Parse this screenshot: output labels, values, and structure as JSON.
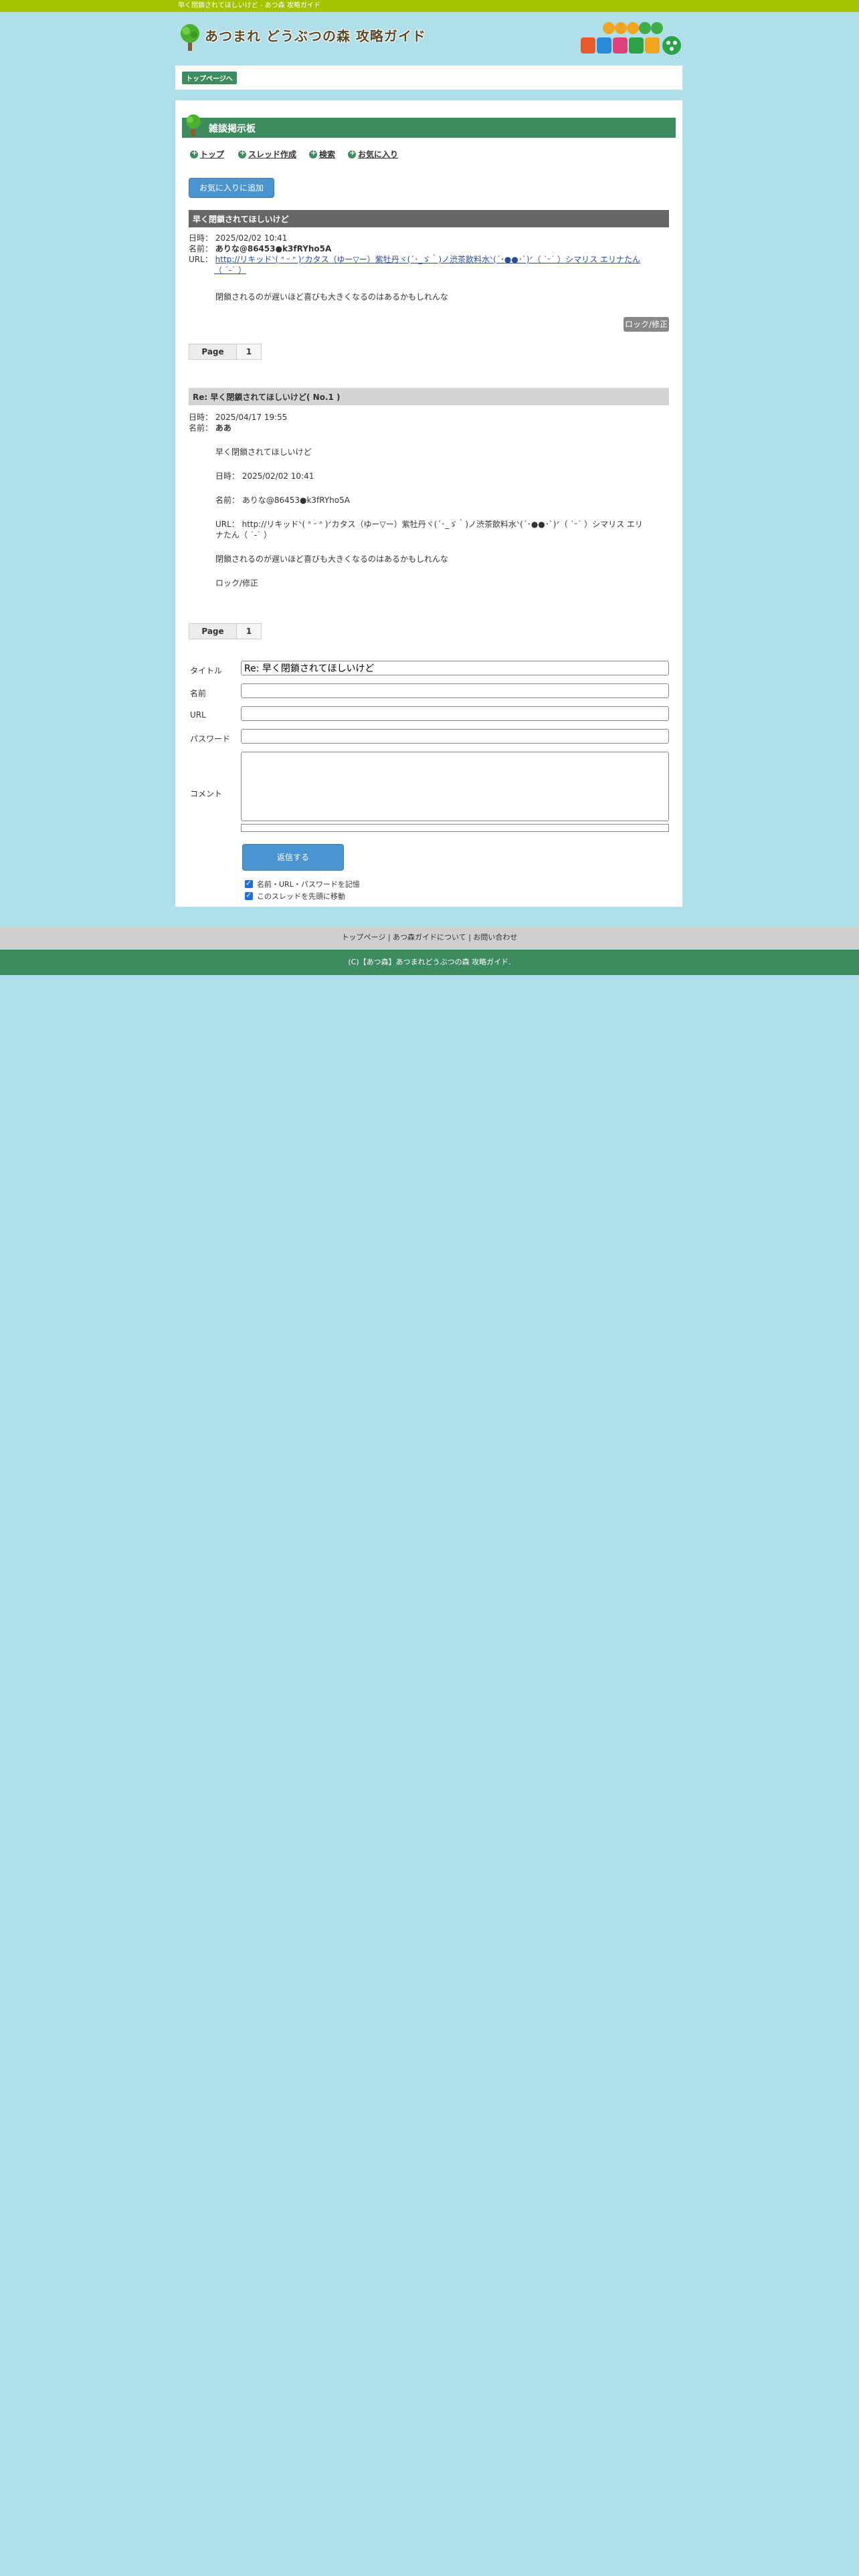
{
  "topbar": {
    "text": "早く閉鎖されてほしいけど - あつ森 攻略ガイド"
  },
  "header": {
    "logo_text": "あつまれ どうぶつの森 攻略ガイド",
    "badge_text": "あつまれ どうぶつの森"
  },
  "breadcrumb": {
    "home": "トップページへ"
  },
  "board": {
    "title": "雑談掲示板"
  },
  "nav": {
    "top": "トップ",
    "create_thread": "スレッド作成",
    "search": "検索",
    "favorites": "お気に入り"
  },
  "fav_button": "お気に入りに追加",
  "thread": {
    "title": "早く閉鎖されてほしいけど",
    "date_label": "日時：",
    "date": "2025/02/02 10:41",
    "name_label": "名前：",
    "name": "ありな@86453●k3fRYho5A",
    "url_label": "URL：",
    "url_line1": "http://リキッドᐠ( ᐢ ᵕ ᐢ )ᐟカタス（ゆー▽ー）紫牡丹ヾ(´･_ゞ｀)ノ渋茶飲料水ᐠ(´･●●･`)ᐟ（ ˙ᵕ˙ ）シマリス エリナたん",
    "url_line2": "（ ˙-˙ ）",
    "body": "閉鎖されるのが遅いほど喜びも大きくなるのはあるかもしれんな",
    "lock_label": "ロック/修正"
  },
  "pager": {
    "label": "Page",
    "current": "1"
  },
  "reply": {
    "title": "Re: 早く閉鎖されてほしいけど( No.1 )",
    "date_label": "日時：",
    "date": "2025/04/17 19:55",
    "name_label": "名前：",
    "name": "ああ",
    "quote_title": "早く閉鎖されてほしいけど",
    "quote_date": "日時： 2025/02/02 10:41",
    "quote_name": "名前： ありな@86453●k3fRYho5A",
    "quote_url_line1": "URL： http://リキッドᐠ( ᐢ ᵕ ᐢ )ᐟカタス（ゆー▽ー）紫牡丹ヾ(´･_ゞ｀)ノ渋茶飲料水ᐠ(´･●●･`)ᐟ（ ˙ᵕ˙ ）シマリス エリ",
    "quote_url_line2": "ナたん（ ˙-˙ ）",
    "quote_body": "閉鎖されるのが遅いほど喜びも大きくなるのはあるかもしれんな",
    "quote_lock": "ロック/修正"
  },
  "form": {
    "title_label": "タイトル",
    "title_value": "Re: 早く閉鎖されてほしいけど",
    "name_label": "名前",
    "url_label": "URL",
    "password_label": "パスワード",
    "comment_label": "コメント",
    "submit_label": "返信する",
    "remember_label": "名前・URL・パスワードを記憶",
    "move_top_label": "このスレッドを先頭に移動"
  },
  "footer": {
    "links": "トップページ | あつ森ガイドについて | お問い合わせ",
    "copyright": "(C)【あつ森】あつまれどうぶつの森 攻略ガイド."
  }
}
